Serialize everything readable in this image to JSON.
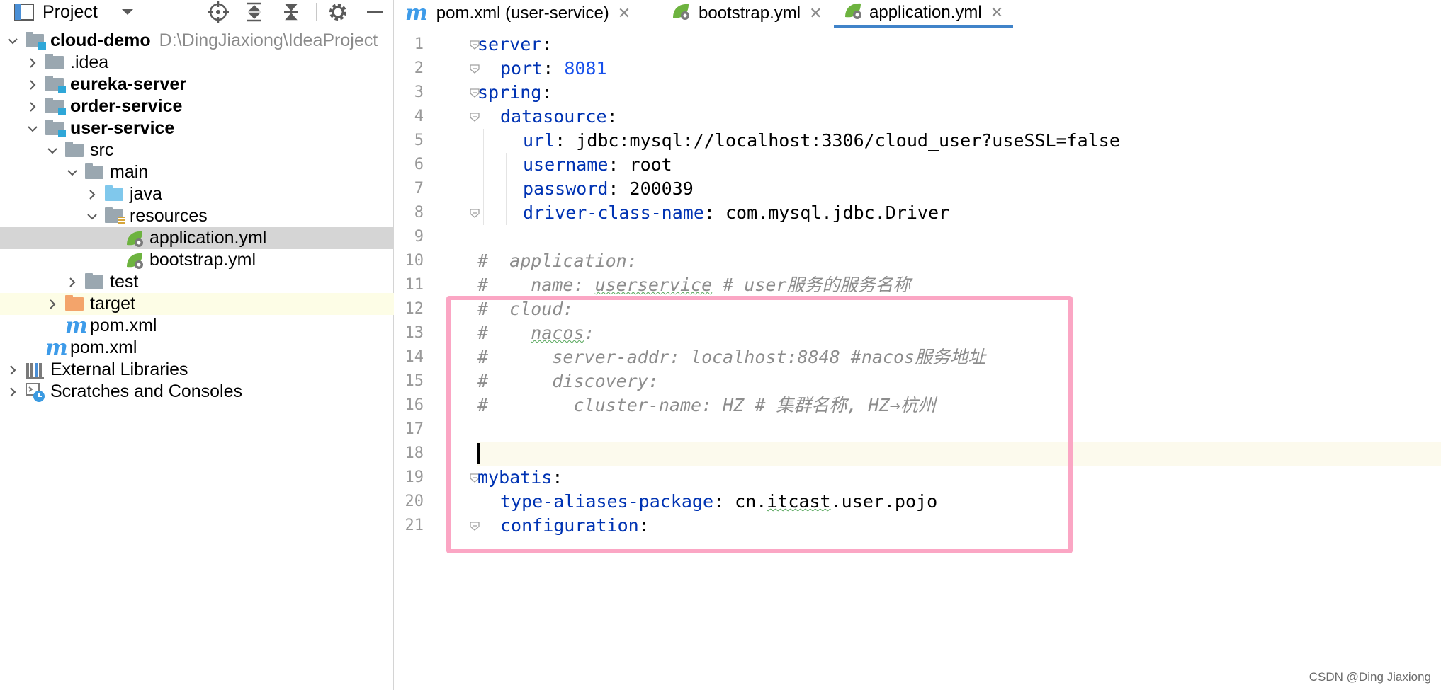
{
  "project_panel": {
    "title": "Project",
    "tree": [
      {
        "label": "cloud-demo",
        "hint": "D:\\DingJiaxiong\\IdeaProject",
        "icon": "module-folder-icon",
        "arrow": "down",
        "depth": 0,
        "bold": true
      },
      {
        "label": ".idea",
        "icon": "folder-icon",
        "arrow": "right",
        "depth": 1
      },
      {
        "label": "eureka-server",
        "icon": "module-folder-icon",
        "arrow": "right",
        "depth": 1,
        "bold": true
      },
      {
        "label": "order-service",
        "icon": "module-folder-icon",
        "arrow": "right",
        "depth": 1,
        "bold": true
      },
      {
        "label": "user-service",
        "icon": "module-folder-icon",
        "arrow": "down",
        "depth": 1,
        "bold": true
      },
      {
        "label": "src",
        "icon": "folder-icon",
        "arrow": "down",
        "depth": 2
      },
      {
        "label": "main",
        "icon": "folder-icon",
        "arrow": "down",
        "depth": 3
      },
      {
        "label": "java",
        "icon": "source-folder-icon",
        "arrow": "right",
        "depth": 4
      },
      {
        "label": "resources",
        "icon": "resources-folder-icon",
        "arrow": "down",
        "depth": 4
      },
      {
        "label": "application.yml",
        "icon": "spring-yml-icon",
        "arrow": "",
        "depth": 5,
        "selected": true
      },
      {
        "label": "bootstrap.yml",
        "icon": "spring-yml-icon",
        "arrow": "",
        "depth": 5
      },
      {
        "label": "test",
        "icon": "folder-icon",
        "arrow": "right",
        "depth": 3
      },
      {
        "label": "target",
        "icon": "excluded-folder-icon",
        "arrow": "right",
        "depth": 2,
        "excluded": true
      },
      {
        "label": "pom.xml",
        "icon": "maven-icon",
        "arrow": "",
        "depth": 2
      },
      {
        "label": "pom.xml",
        "icon": "maven-icon",
        "arrow": "",
        "depth": 1
      },
      {
        "label": "External Libraries",
        "icon": "libraries-icon",
        "arrow": "right",
        "depth": 0
      },
      {
        "label": "Scratches and Consoles",
        "icon": "scratches-icon",
        "arrow": "right",
        "depth": 0
      }
    ]
  },
  "tabs": [
    {
      "label": "pom.xml (user-service)",
      "icon": "maven-icon",
      "active": false
    },
    {
      "label": "bootstrap.yml",
      "icon": "spring-yml-icon",
      "active": false
    },
    {
      "label": "application.yml",
      "icon": "spring-yml-icon",
      "active": true
    }
  ],
  "editor": {
    "lines": [
      {
        "n": "1",
        "indent": 0,
        "tokens": [
          {
            "t": "server",
            "c": "k"
          },
          {
            "t": ":",
            "c": "p"
          }
        ]
      },
      {
        "n": "2",
        "indent": 1,
        "tokens": [
          {
            "t": "port",
            "c": "k"
          },
          {
            "t": ": ",
            "c": "p"
          },
          {
            "t": "8081",
            "c": "n"
          }
        ]
      },
      {
        "n": "3",
        "indent": 0,
        "tokens": [
          {
            "t": "spring",
            "c": "k"
          },
          {
            "t": ":",
            "c": "p"
          }
        ]
      },
      {
        "n": "4",
        "indent": 1,
        "tokens": [
          {
            "t": "datasource",
            "c": "k"
          },
          {
            "t": ":",
            "c": "p"
          }
        ]
      },
      {
        "n": "5",
        "indent": 2,
        "tokens": [
          {
            "t": "url",
            "c": "k"
          },
          {
            "t": ": ",
            "c": "p"
          },
          {
            "t": "jdbc:mysql://localhost:3306/cloud_user?useSSL=false",
            "c": "s"
          }
        ]
      },
      {
        "n": "6",
        "indent": 2,
        "tokens": [
          {
            "t": "username",
            "c": "k"
          },
          {
            "t": ": ",
            "c": "p"
          },
          {
            "t": "root",
            "c": "s"
          }
        ]
      },
      {
        "n": "7",
        "indent": 2,
        "tokens": [
          {
            "t": "password",
            "c": "k"
          },
          {
            "t": ": ",
            "c": "p"
          },
          {
            "t": "200039",
            "c": "s"
          }
        ]
      },
      {
        "n": "8",
        "indent": 2,
        "tokens": [
          {
            "t": "driver-class-name",
            "c": "k"
          },
          {
            "t": ": ",
            "c": "p"
          },
          {
            "t": "com.mysql.jdbc.Driver",
            "c": "s"
          }
        ]
      },
      {
        "n": "9",
        "indent": 0,
        "tokens": []
      },
      {
        "n": "10",
        "indent": 0,
        "tokens": [
          {
            "t": "#  application:",
            "c": "c"
          }
        ]
      },
      {
        "n": "11",
        "indent": 0,
        "tokens": [
          {
            "t": "#    name: ",
            "c": "c"
          },
          {
            "t": "userservice",
            "c": "c squig"
          },
          {
            "t": " # user服务的服务名称",
            "c": "c"
          }
        ]
      },
      {
        "n": "12",
        "indent": 0,
        "tokens": [
          {
            "t": "#  cloud:",
            "c": "c"
          }
        ]
      },
      {
        "n": "13",
        "indent": 0,
        "tokens": [
          {
            "t": "#    ",
            "c": "c"
          },
          {
            "t": "nacos",
            "c": "c squig"
          },
          {
            "t": ":",
            "c": "c"
          }
        ]
      },
      {
        "n": "14",
        "indent": 0,
        "tokens": [
          {
            "t": "#      server-addr: localhost:8848 #nacos服务地址",
            "c": "c"
          }
        ]
      },
      {
        "n": "15",
        "indent": 0,
        "tokens": [
          {
            "t": "#      discovery:",
            "c": "c"
          }
        ]
      },
      {
        "n": "16",
        "indent": 0,
        "tokens": [
          {
            "t": "#        cluster-name: HZ # 集群名称, HZ→杭州",
            "c": "c"
          }
        ]
      },
      {
        "n": "17",
        "indent": 0,
        "tokens": []
      },
      {
        "n": "18",
        "indent": 0,
        "tokens": []
      },
      {
        "n": "19",
        "indent": 0,
        "tokens": [
          {
            "t": "mybatis",
            "c": "k"
          },
          {
            "t": ":",
            "c": "p"
          }
        ]
      },
      {
        "n": "20",
        "indent": 1,
        "tokens": [
          {
            "t": "type-aliases-package",
            "c": "k"
          },
          {
            "t": ": ",
            "c": "p"
          },
          {
            "t": "cn.",
            "c": "s"
          },
          {
            "t": "itcast",
            "c": "s squig"
          },
          {
            "t": ".user.pojo",
            "c": "s"
          }
        ]
      },
      {
        "n": "21",
        "indent": 1,
        "tokens": [
          {
            "t": "configuration",
            "c": "k"
          },
          {
            "t": ":",
            "c": "p"
          }
        ]
      }
    ],
    "current_line": "18"
  },
  "watermark": "CSDN @Ding Jiaxiong",
  "colors": {
    "accent": "#4083c9",
    "highlight_box": "#fba6c4",
    "keyword": "#0033b3",
    "number": "#1750eb",
    "comment": "#8c8c8c"
  }
}
